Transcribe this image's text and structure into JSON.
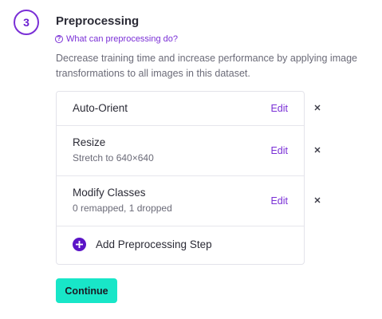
{
  "step": {
    "number": "3",
    "title": "Preprocessing",
    "help_link": "What can preprocessing do?",
    "help_icon": "question-circle-icon",
    "description": "Decrease training time and increase performance by applying image transformations to all images in this dataset."
  },
  "preprocessing_steps": [
    {
      "title": "Auto-Orient",
      "subtitle": "",
      "edit_label": "Edit",
      "remove_icon": "close-icon"
    },
    {
      "title": "Resize",
      "subtitle": "Stretch to 640×640",
      "edit_label": "Edit",
      "remove_icon": "close-icon"
    },
    {
      "title": "Modify Classes",
      "subtitle": "0 remapped, 1 dropped",
      "edit_label": "Edit",
      "remove_icon": "close-icon"
    }
  ],
  "add_step": {
    "label": "Add Preprocessing Step",
    "icon": "plus-circle-icon"
  },
  "continue_button": {
    "label": "Continue"
  },
  "colors": {
    "accent_purple": "#7a2fd6",
    "add_icon_purple": "#5b14c7",
    "continue_teal": "#18e6c8"
  }
}
